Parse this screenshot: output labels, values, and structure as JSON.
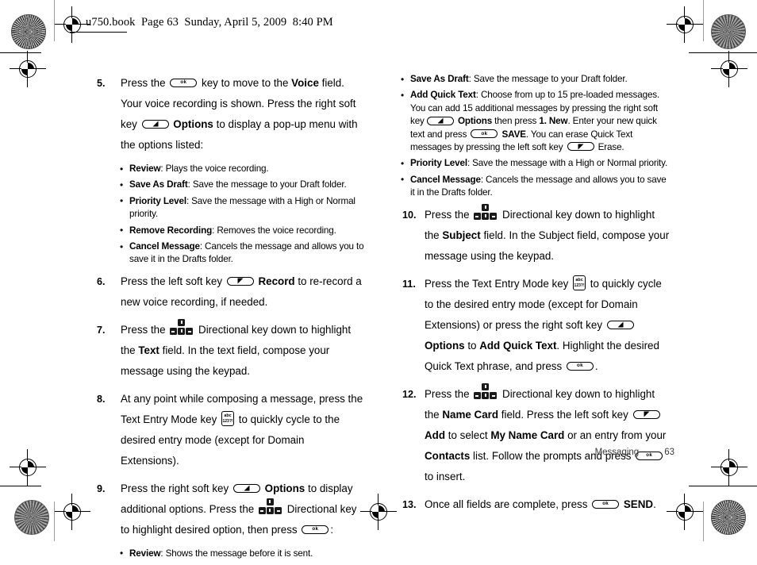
{
  "header": {
    "book_line": "u750.book  Page 63  Sunday, April 5, 2009  8:40 PM"
  },
  "footer": {
    "section": "Messaging",
    "page_number": "63"
  },
  "icons": {
    "ok_key": "ok",
    "tem_top": "abc",
    "tem_bottom": "123?!",
    "ok_key_name": "ok-key-icon",
    "right_soft_key_name": "right-soft-key-icon",
    "left_soft_key_name": "left-soft-key-icon",
    "directional_key_name": "directional-key-icon",
    "text_entry_mode_key_name": "text-entry-mode-key-icon"
  },
  "left_column": {
    "steps": [
      {
        "num": "5.",
        "parts": [
          "Press the ",
          " key to move to the ",
          "Voice",
          " field. Your voice recording is shown. Press the right soft key ",
          "Options",
          " to display a pop-up menu with the options listed:"
        ],
        "bullets": [
          {
            "term": "Review",
            "text": ": Plays the voice recording."
          },
          {
            "term": "Save As Draft",
            "text": ": Save the message to your Draft folder."
          },
          {
            "term": "Priority Level",
            "text": ": Save the message with a High or Normal priority."
          },
          {
            "term": "Remove Recording",
            "text": ": Removes the voice recording."
          },
          {
            "term": "Cancel Message",
            "text": ": Cancels the message and allows you to save it in the Drafts folder."
          }
        ]
      },
      {
        "num": "6.",
        "parts": [
          "Press the left soft key ",
          "Record",
          " to re-record a new voice recording, if needed."
        ]
      },
      {
        "num": "7.",
        "parts": [
          "Press the ",
          " Directional key down to highlight the ",
          "Text",
          " field. In the text field, compose your message using the keypad."
        ]
      },
      {
        "num": "8.",
        "parts": [
          "At any point while composing a message, press the Text Entry Mode key ",
          " to quickly cycle to the desired entry mode (except for Domain Extensions)."
        ]
      },
      {
        "num": "9.",
        "parts": [
          "Press the right soft key ",
          "Options",
          " to display additional options. Press the ",
          " Directional key to highlight desired option, then press ",
          ":"
        ],
        "bullets": [
          {
            "term": "Review",
            "text": ": Shows the message before it is sent."
          }
        ]
      }
    ]
  },
  "right_column": {
    "top_bullets": [
      {
        "term": "Save As Draft",
        "text": ": Save the message to your Draft folder."
      },
      {
        "term": "Add Quick Text",
        "text_a": ": Choose from up to 15 pre-loaded messages. You can add 15 additional messages by pressing the right soft key ",
        "opt_label": "Options",
        "text_b": " then press ",
        "new_label": "1. New",
        "text_c": ". Enter your new quick text and press ",
        "save_label": "SAVE",
        "text_d": ". You can erase Quick Text messages by pressing the left soft key ",
        "text_e": " Erase."
      },
      {
        "term": "Priority Level",
        "text": ": Save the message with a High or Normal priority."
      },
      {
        "term": "Cancel Message",
        "text": ": Cancels the message and allows you to save it in the Drafts folder."
      }
    ],
    "steps": [
      {
        "num": "10.",
        "parts": [
          "Press the ",
          " Directional key down to highlight the ",
          "Subject",
          " field. In the Subject field, compose your message using the keypad."
        ]
      },
      {
        "num": "11.",
        "parts": [
          "Press the Text Entry Mode key ",
          " to quickly cycle to the desired entry mode (except for Domain Extensions) or press the right soft key ",
          "Options",
          " to ",
          "Add Quick Text",
          ". Highlight the desired Quick Text phrase, and press ",
          "."
        ]
      },
      {
        "num": "12.",
        "parts": [
          "Press the ",
          " Directional key down to highlight the ",
          "Name Card",
          " field. Press the left soft key ",
          "Add",
          " to select ",
          "My Name Card",
          " or an entry from your ",
          "Contacts",
          " list. Follow the prompts and press ",
          " to insert."
        ]
      },
      {
        "num": "13.",
        "parts": [
          "Once all fields are complete, press ",
          "SEND",
          "."
        ]
      }
    ]
  }
}
